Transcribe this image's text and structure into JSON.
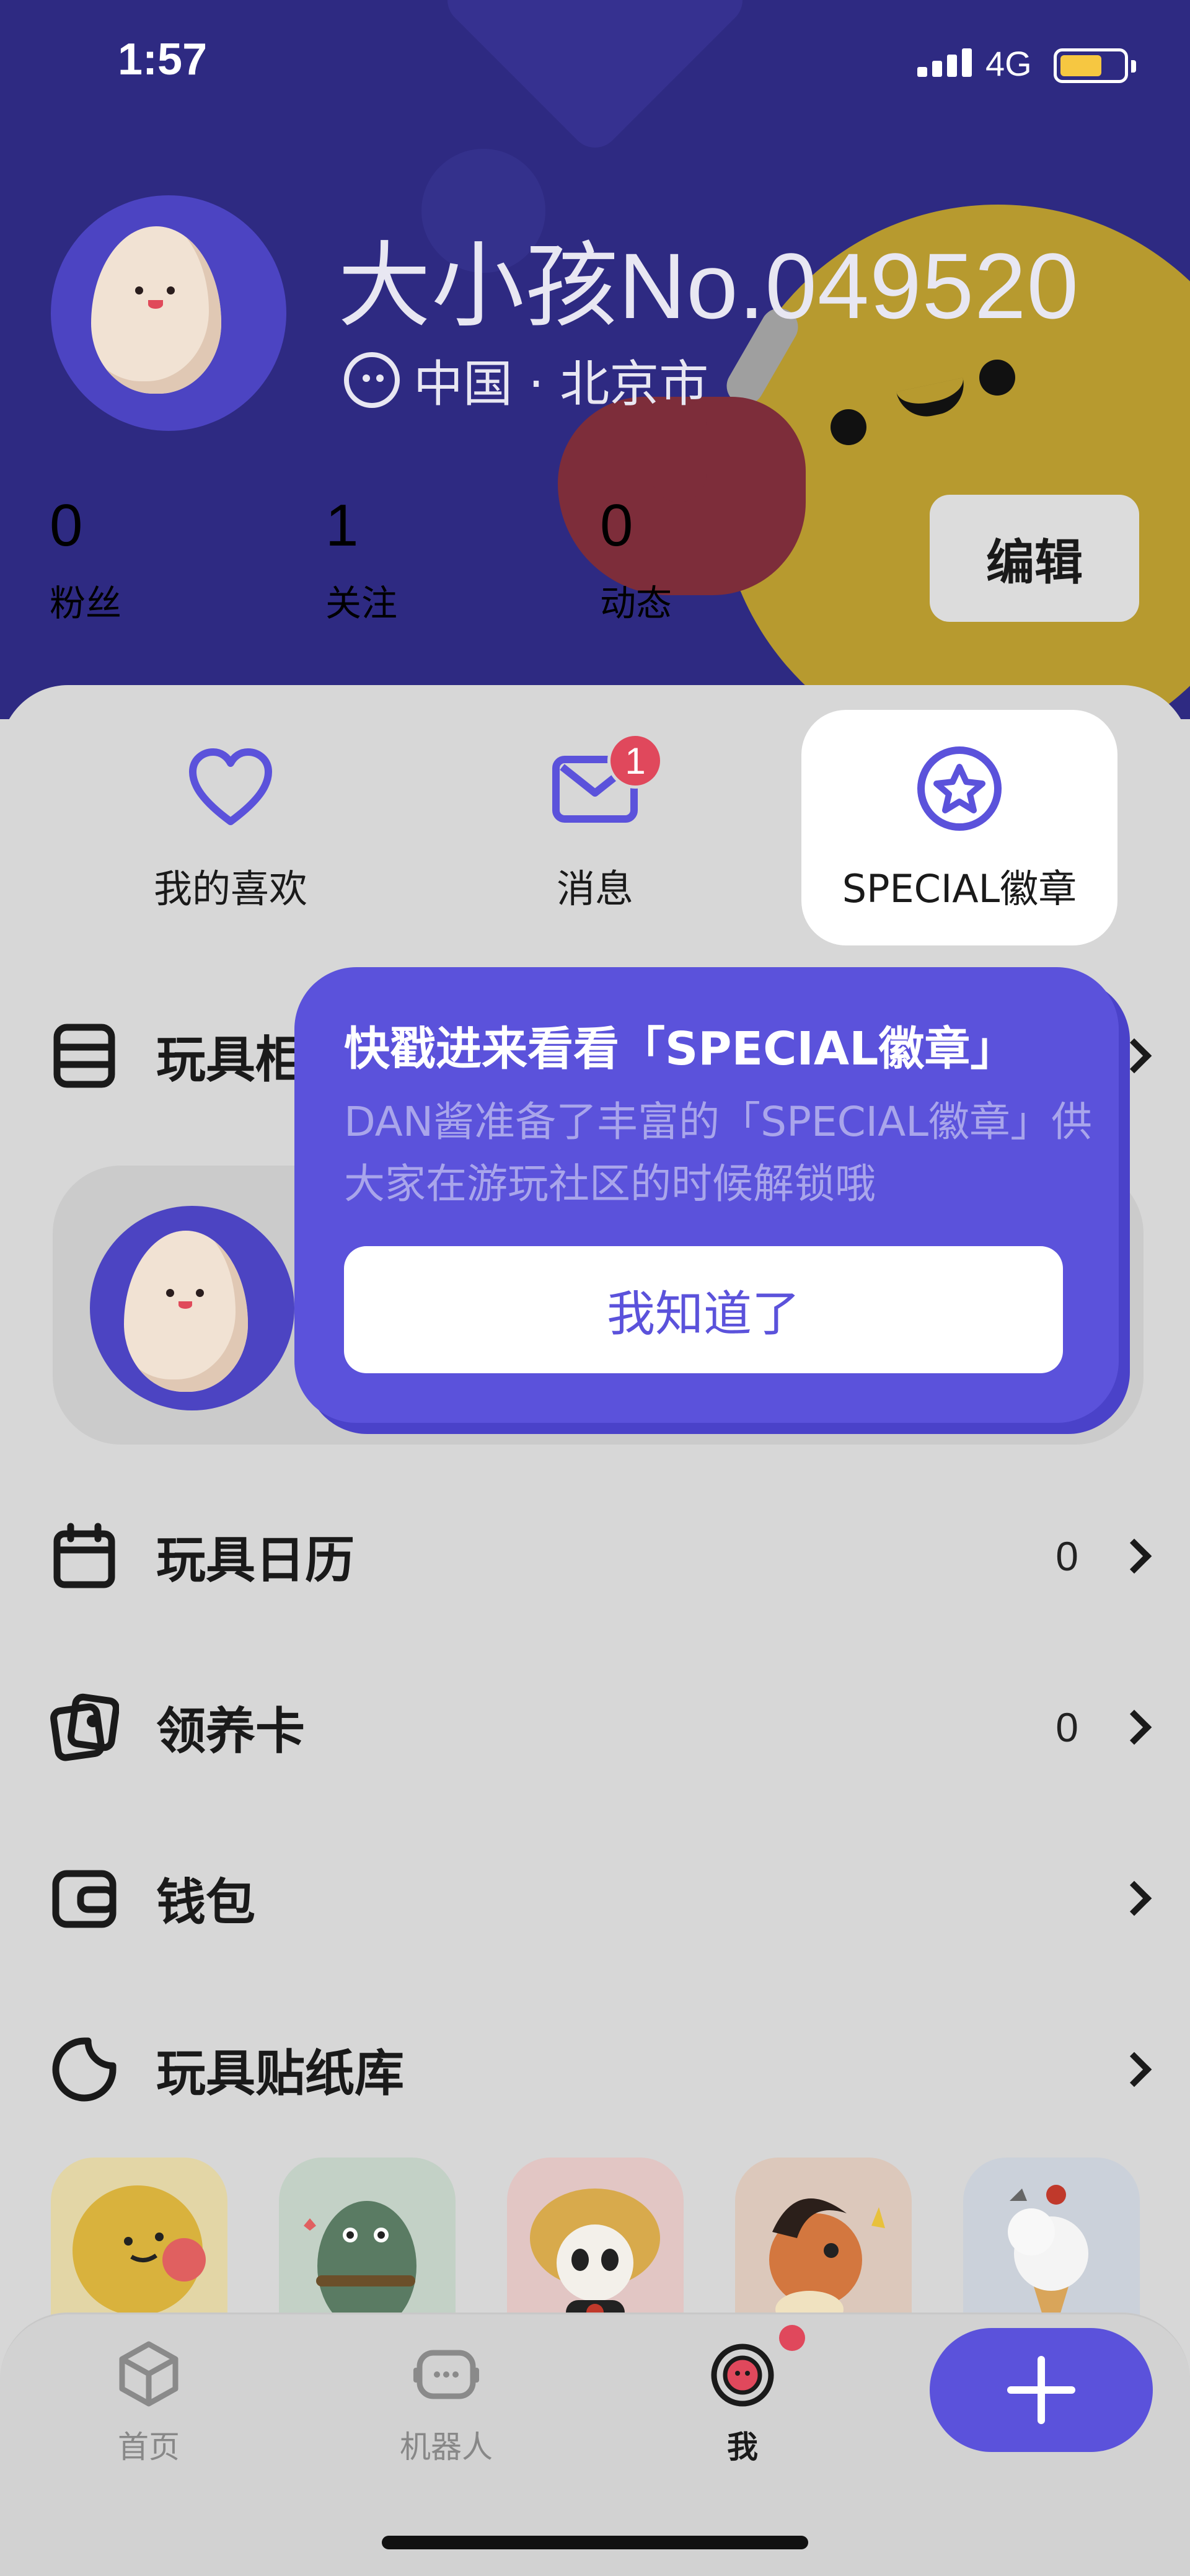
{
  "status_bar": {
    "time": "1:57",
    "network": "4G"
  },
  "profile": {
    "username": "大小孩No.049520",
    "location": "中国 · 北京市",
    "stats": [
      {
        "count": "0",
        "label": "粉丝"
      },
      {
        "count": "1",
        "label": "关注"
      },
      {
        "count": "0",
        "label": "动态"
      }
    ],
    "edit_label": "编辑"
  },
  "quick_actions": [
    {
      "label": "我的喜欢",
      "icon": "heart-icon"
    },
    {
      "label": "消息",
      "icon": "mail-icon",
      "badge": "1"
    },
    {
      "label": "SPECIAL徽章",
      "icon": "star-badge-icon"
    }
  ],
  "tooltip": {
    "title": "快戳进来看看「SPECIAL徽章」",
    "desc_line1": "DAN酱准备了丰富的「SPECIAL徽章」供",
    "desc_line2": "大家在游玩社区的时候解锁哦",
    "button": "我知道了"
  },
  "menu": {
    "toy_cabinet_label": "玩具柜",
    "items": [
      {
        "label": "玩具日历",
        "count": "0",
        "icon": "calendar-icon"
      },
      {
        "label": "领养卡",
        "count": "0",
        "icon": "adoption-card-icon"
      },
      {
        "label": "钱包",
        "count": "",
        "icon": "wallet-icon"
      },
      {
        "label": "玩具贴纸库",
        "count": "",
        "icon": "sticker-icon"
      }
    ]
  },
  "tabbar": {
    "tabs": [
      {
        "label": "首页",
        "icon": "home-icon"
      },
      {
        "label": "机器人",
        "icon": "robot-icon"
      },
      {
        "label": "我",
        "icon": "me-icon"
      }
    ]
  },
  "colors": {
    "header": "#2e2a82",
    "accent": "#5b52db",
    "badge": "#e0485c"
  }
}
